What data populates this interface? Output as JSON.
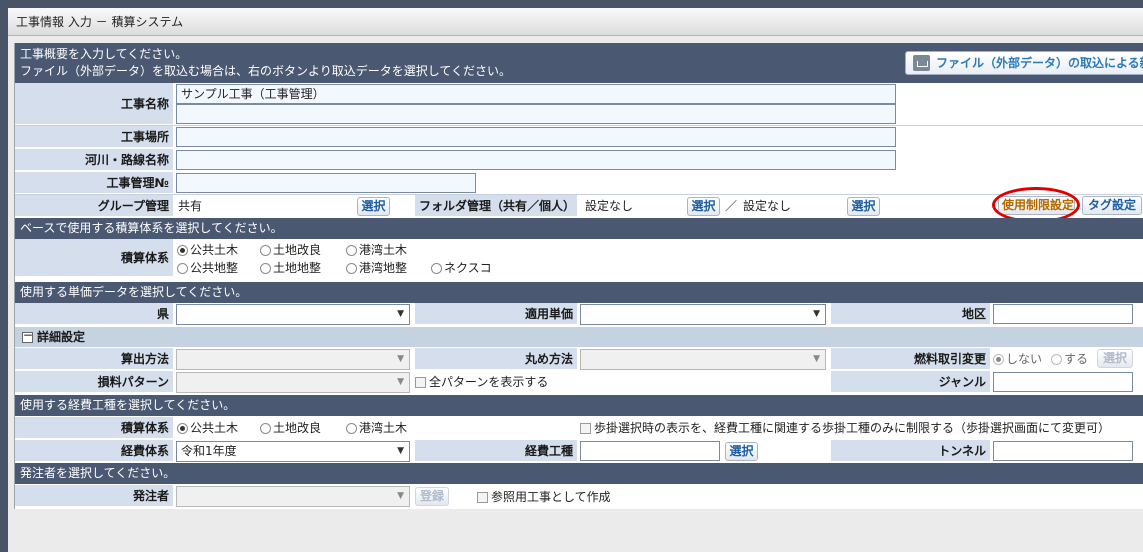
{
  "window": {
    "title": "工事情報 入力 － 積算システム"
  },
  "intro": {
    "line1": "工事概要を入力してください。",
    "line2": "ファイル（外部データ）を取込む場合は、右のボタンより取込データを選択してください。",
    "import_button": "ファイル（外部データ）の取込による新規作成"
  },
  "basic": {
    "name_label": "工事名称",
    "name_value": "サンプル工事（工事管理）",
    "name_value2": "",
    "place_label": "工事場所",
    "place_value": "",
    "river_label": "河川・路線名称",
    "river_value": "",
    "mgmt_label": "工事管理№",
    "mgmt_value": "",
    "group_label": "グループ管理",
    "group_value": "共有",
    "select_label": "選択",
    "folder_label": "フォルダ管理（共有／個人）",
    "folder_value1": "設定なし",
    "folder_sep": "／",
    "folder_value2": "設定なし",
    "use_limit_button": "使用制限設定",
    "tag_button": "タグ設定"
  },
  "system": {
    "header": "ベースで使用する積算体系を選択してください。",
    "label": "積算体系",
    "options": [
      "公共土木",
      "土地改良",
      "港湾土木",
      "公共地整",
      "土地地整",
      "港湾地整",
      "ネクスコ"
    ],
    "selected": "公共土木"
  },
  "unit": {
    "header": "使用する単価データを選択してください。",
    "pref_label": "県",
    "apply_label": "適用単価",
    "area_label": "地区"
  },
  "detail": {
    "title": "詳細設定",
    "calc_label": "算出方法",
    "round_label": "丸め方法",
    "fuel_label": "燃料取引変更",
    "fuel_options": [
      "しない",
      "する"
    ],
    "fuel_select": "選択",
    "loss_label": "損料パターン",
    "all_patterns": "全パターンを表示する",
    "genre_label": "ジャンル"
  },
  "expense": {
    "header": "使用する経費工種を選択してください。",
    "system_label": "積算体系",
    "options": [
      "公共土木",
      "土地改良",
      "港湾土木"
    ],
    "selected": "公共土木",
    "restrict_text": "歩掛選択時の表示を、経費工種に関連する歩掛工種のみに制限する（歩掛選択画面にて変更可）",
    "expense_system_label": "経費体系",
    "expense_system_value": "令和1年度",
    "expense_type_label": "経費工種",
    "select_label": "選択",
    "tunnel_label": "トンネル"
  },
  "orderer": {
    "header": "発注者を選択してください。",
    "label": "発注者",
    "register_button": "登録",
    "reference_text": "参照用工事として作成"
  }
}
